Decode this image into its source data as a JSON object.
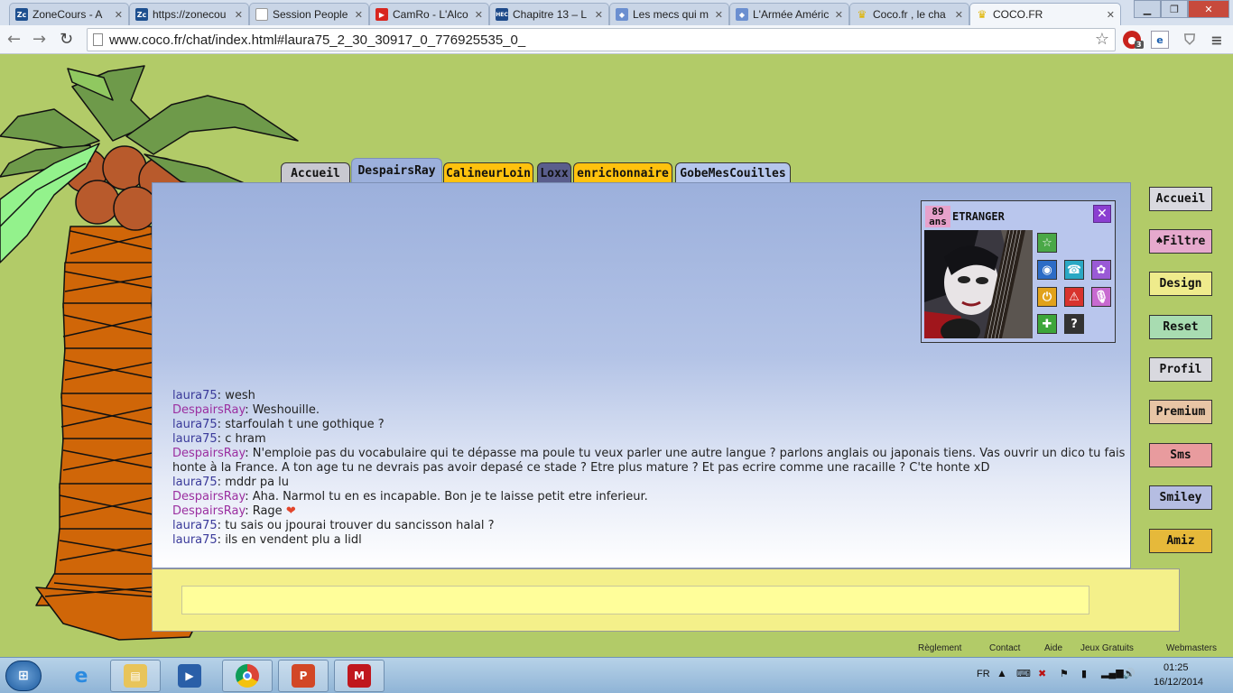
{
  "browser": {
    "tabs": [
      {
        "title": "ZoneCours - A",
        "favicon": "Zc"
      },
      {
        "title": "https://zonecou",
        "favicon": "Zc"
      },
      {
        "title": "Session People",
        "favicon": "doc"
      },
      {
        "title": "CamRo - L'Alco",
        "favicon": "yt"
      },
      {
        "title": "Chapitre 13 – L",
        "favicon": "HEC"
      },
      {
        "title": "Les mecs qui m",
        "favicon": "game"
      },
      {
        "title": "L'Armée Améric",
        "favicon": "game"
      },
      {
        "title": "Coco.fr , le cha",
        "favicon": "crown"
      },
      {
        "title": "COCO.FR",
        "favicon": "crown"
      }
    ],
    "url": "www.coco.fr/chat/index.html#laura75_2_30_30917_0_776925535_0_",
    "extension_badge": "3"
  },
  "chat": {
    "tabs": [
      {
        "label": "Accueil",
        "color": "#c8c8d0"
      },
      {
        "label": "DespairsRay",
        "color": "#9cb0dc"
      },
      {
        "label": "CalineurLoin",
        "color": "#ffc20e"
      },
      {
        "label": "Loxx",
        "color": "#5a5e8c"
      },
      {
        "label": "enrichonnaire",
        "color": "#ffc20e"
      },
      {
        "label": "GobeMesCouilles",
        "color": "#b5c6ec"
      }
    ],
    "messages": [
      {
        "nick": "laura75",
        "text": "wesh",
        "self": true
      },
      {
        "nick": "DespairsRay",
        "text": "Weshouille.",
        "self": false
      },
      {
        "nick": "laura75",
        "text": "starfoulah t une gothique ?",
        "self": true
      },
      {
        "nick": "laura75",
        "text": "c hram",
        "self": true
      },
      {
        "nick": "DespairsRay",
        "text": "N'emploie pas du vocabulaire qui te dépasse ma poule tu veux parler une autre langue ? parlons anglais ou japonais tiens. Vas ouvrir un dico tu fais honte à la France. A ton age tu ne devrais pas avoir depasé ce stade ? Etre plus mature ? Et pas ecrire comme une racaille ? C'te honte xD",
        "self": false
      },
      {
        "nick": "laura75",
        "text": "mddr pa lu",
        "self": true
      },
      {
        "nick": "DespairsRay",
        "text": "Aha. Narmol tu en es incapable. Bon je te laisse petit etre inferieur.",
        "self": false
      },
      {
        "nick": "DespairsRay",
        "text": "Rage",
        "self": false,
        "emoji": "❤"
      },
      {
        "nick": "laura75",
        "text": "tu sais ou jpourai trouver du sancisson halal ?",
        "self": true
      },
      {
        "nick": "laura75",
        "text": "ils en vendent plu a lidl",
        "self": true
      }
    ],
    "input_value": ""
  },
  "profile": {
    "age_num": "89",
    "age_unit": "ans",
    "name": "ETRANGER",
    "icons": [
      "star-icon",
      "webcam-icon",
      "phone-icon",
      "flower-icon",
      "power-icon",
      "warning-icon",
      "microphone-icon",
      "plus-icon",
      "question-icon"
    ]
  },
  "sidebar": [
    {
      "label": "Accueil",
      "color": "#d9d9df"
    },
    {
      "label": "♠Filtre",
      "color": "#e6a9cd"
    },
    {
      "label": "Design",
      "color": "#efeb8c"
    },
    {
      "label": "Reset",
      "color": "#a8dcb1"
    },
    {
      "label": "Profil",
      "color": "#d9d9df"
    },
    {
      "label": "Premium",
      "color": "#e8c5a5"
    },
    {
      "label": "Sms",
      "color": "#e89b9e"
    },
    {
      "label": "Smiley",
      "color": "#b5bde2"
    },
    {
      "label": "Amiz",
      "color": "#e6b93a"
    }
  ],
  "footer": [
    "Règlement",
    "Contact",
    "Aide",
    "Jeux Gratuits",
    "Webmasters"
  ],
  "taskbar": {
    "lang": "FR",
    "time": "01:25",
    "date": "16/12/2014"
  }
}
